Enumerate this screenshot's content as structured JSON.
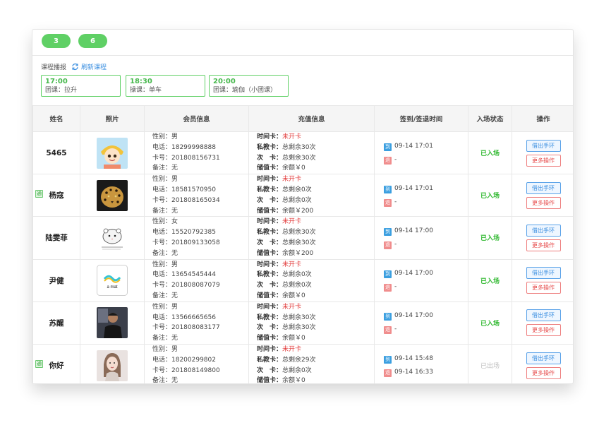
{
  "header": {
    "pills": [
      "3",
      "6"
    ]
  },
  "course": {
    "label": "课程播报",
    "refresh_label": "刷新课程",
    "items": [
      {
        "time": "17:00",
        "name": "团课：拉升"
      },
      {
        "time": "18:30",
        "name": "操课：单车"
      },
      {
        "time": "20:00",
        "name": "团课：瑜伽（小团课）"
      }
    ]
  },
  "table": {
    "headers": [
      "姓名",
      "照片",
      "会员信息",
      "充值信息",
      "签到/签退时间",
      "入场状态",
      "操作"
    ],
    "rows": [
      {
        "tag": "",
        "name": "5465",
        "photo": "cartoon-girl-avatar",
        "gender": "性别：男",
        "phone": "电话：18299998888",
        "card": "卡号：201808156731",
        "note": "备注：无",
        "time_card_k": "时间卡：",
        "time_card_v": "未开卡",
        "private_k": "私教卡：",
        "private_v": "总剩余30次",
        "count_k": "次　卡：",
        "count_v": "总剩余30次",
        "stored_k": "储值卡：",
        "stored_v": "余额￥0",
        "in_badge": "到",
        "in_time": "09-14 17:01",
        "out_badge": "退",
        "out_time": "-",
        "status": "已入场",
        "status_type": "in",
        "op1": "借出手环",
        "op2": "更多操作"
      },
      {
        "tag": "通",
        "name": "杨寇",
        "photo": "leopard-photo",
        "gender": "性别：男",
        "phone": "电话：18581570950",
        "card": "卡号：201808165034",
        "note": "备注：无",
        "time_card_k": "时间卡：",
        "time_card_v": "未开卡",
        "private_k": "私教卡：",
        "private_v": "总剩余0次",
        "count_k": "次　卡：",
        "count_v": "总剩余0次",
        "stored_k": "储值卡：",
        "stored_v": "余额￥200",
        "in_badge": "到",
        "in_time": "09-14 17:01",
        "out_badge": "退",
        "out_time": "-",
        "status": "已入场",
        "status_type": "in",
        "op1": "借出手环",
        "op2": "更多操作"
      },
      {
        "tag": "",
        "name": "陆雯菲",
        "photo": "hamster-sketch",
        "gender": "性别：女",
        "phone": "电话：15520792385",
        "card": "卡号：201809133058",
        "note": "备注：无",
        "time_card_k": "时间卡：",
        "time_card_v": "未开卡",
        "private_k": "私教卡：",
        "private_v": "总剩余30次",
        "count_k": "次　卡：",
        "count_v": "总剩余30次",
        "stored_k": "储值卡：",
        "stored_v": "余额￥200",
        "in_badge": "到",
        "in_time": "09-14 17:00",
        "out_badge": "退",
        "out_time": "-",
        "status": "已入场",
        "status_type": "in",
        "op1": "借出手环",
        "op2": "更多操作"
      },
      {
        "tag": "",
        "name": "尹健",
        "photo": "amat-logo",
        "photo_text": "a mat",
        "gender": "性别：男",
        "phone": "电话：13654545444",
        "card": "卡号：201808087079",
        "note": "备注：无",
        "time_card_k": "时间卡：",
        "time_card_v": "未开卡",
        "private_k": "私教卡：",
        "private_v": "总剩余0次",
        "count_k": "次　卡：",
        "count_v": "总剩余0次",
        "stored_k": "储值卡：",
        "stored_v": "余额￥0",
        "in_badge": "到",
        "in_time": "09-14 17:00",
        "out_badge": "退",
        "out_time": "-",
        "status": "已入场",
        "status_type": "in",
        "op1": "借出手环",
        "op2": "更多操作"
      },
      {
        "tag": "",
        "name": "苏醒",
        "photo": "man-photo",
        "gender": "性别：男",
        "phone": "电话：13566665656",
        "card": "卡号：201808083177",
        "note": "备注：无",
        "time_card_k": "时间卡：",
        "time_card_v": "未开卡",
        "private_k": "私教卡：",
        "private_v": "总剩余30次",
        "count_k": "次　卡：",
        "count_v": "总剩余30次",
        "stored_k": "储值卡：",
        "stored_v": "余额￥0",
        "in_badge": "到",
        "in_time": "09-14 17:00",
        "out_badge": "退",
        "out_time": "-",
        "status": "已入场",
        "status_type": "in",
        "op1": "借出手环",
        "op2": "更多操作"
      },
      {
        "tag": "通",
        "name": "你好",
        "photo": "woman-photo",
        "gender": "性别：男",
        "phone": "电话：18200299802",
        "card": "卡号：201808149800",
        "note": "备注：无",
        "time_card_k": "时间卡：",
        "time_card_v": "未开卡",
        "private_k": "私教卡：",
        "private_v": "总剩余29次",
        "count_k": "次　卡：",
        "count_v": "总剩余0次",
        "stored_k": "储值卡：",
        "stored_v": "余额￥0",
        "in_badge": "到",
        "in_time": "09-14 15:48",
        "out_badge": "退",
        "out_time": "09-14 16:33",
        "status": "已出场",
        "status_type": "out",
        "op1": "借出手环",
        "op2": "更多操作"
      }
    ]
  }
}
